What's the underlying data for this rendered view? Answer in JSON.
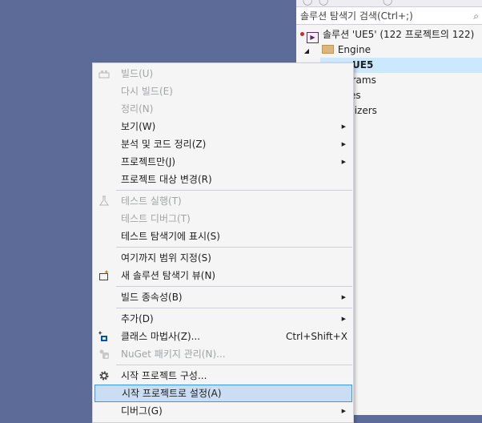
{
  "solution_explorer": {
    "search_placeholder": "솔루션 탐색기 검색(Ctrl+;)",
    "tree": [
      {
        "label": "솔루션 'UE5'   (122 프로젝트의 122)",
        "icon": "solution-icon",
        "status": "error"
      },
      {
        "label": "Engine",
        "icon": "folder-icon",
        "expanded": true
      },
      {
        "label": "UE5",
        "icon": "project-icon",
        "selected": true
      },
      {
        "label": "grams"
      },
      {
        "label": "es"
      },
      {
        "label": "alizers"
      }
    ]
  },
  "context_menu": {
    "items": [
      {
        "label": "빌드(U)",
        "enabled": false,
        "icon": "build-icon"
      },
      {
        "label": "다시 빌드(E)",
        "enabled": false
      },
      {
        "label": "정리(N)",
        "enabled": false
      },
      {
        "label": "보기(W)",
        "enabled": true,
        "submenu": true
      },
      {
        "label": "분석 및 코드 정리(Z)",
        "enabled": true,
        "submenu": true
      },
      {
        "label": "프로젝트만(J)",
        "enabled": true,
        "submenu": true
      },
      {
        "label": "프로젝트 대상 변경(R)",
        "enabled": true
      },
      {
        "label": "테스트 실행(T)",
        "enabled": false,
        "icon": "test-icon"
      },
      {
        "label": "테스트 디버그(T)",
        "enabled": false
      },
      {
        "label": "테스트 탐색기에 표시(S)",
        "enabled": true
      },
      {
        "label": "여기까지 범위 지정(S)",
        "enabled": true
      },
      {
        "label": "새 솔루션 탐색기 뷰(N)",
        "enabled": true,
        "icon": "new-view-icon"
      },
      {
        "label": "빌드 종속성(B)",
        "enabled": true,
        "submenu": true
      },
      {
        "label": "추가(D)",
        "enabled": true,
        "submenu": true
      },
      {
        "label": "클래스 마법사(Z)...",
        "enabled": true,
        "icon": "class-wizard-icon",
        "shortcut": "Ctrl+Shift+X"
      },
      {
        "label": "NuGet 패키지 관리(N)...",
        "enabled": false,
        "icon": "nuget-icon"
      },
      {
        "label": "시작 프로젝트 구성...",
        "enabled": true,
        "icon": "gear-icon"
      },
      {
        "label": "시작 프로젝트로 설정(A)",
        "enabled": true,
        "highlighted": true
      },
      {
        "label": "디버그(G)",
        "enabled": true,
        "submenu": true
      }
    ]
  }
}
